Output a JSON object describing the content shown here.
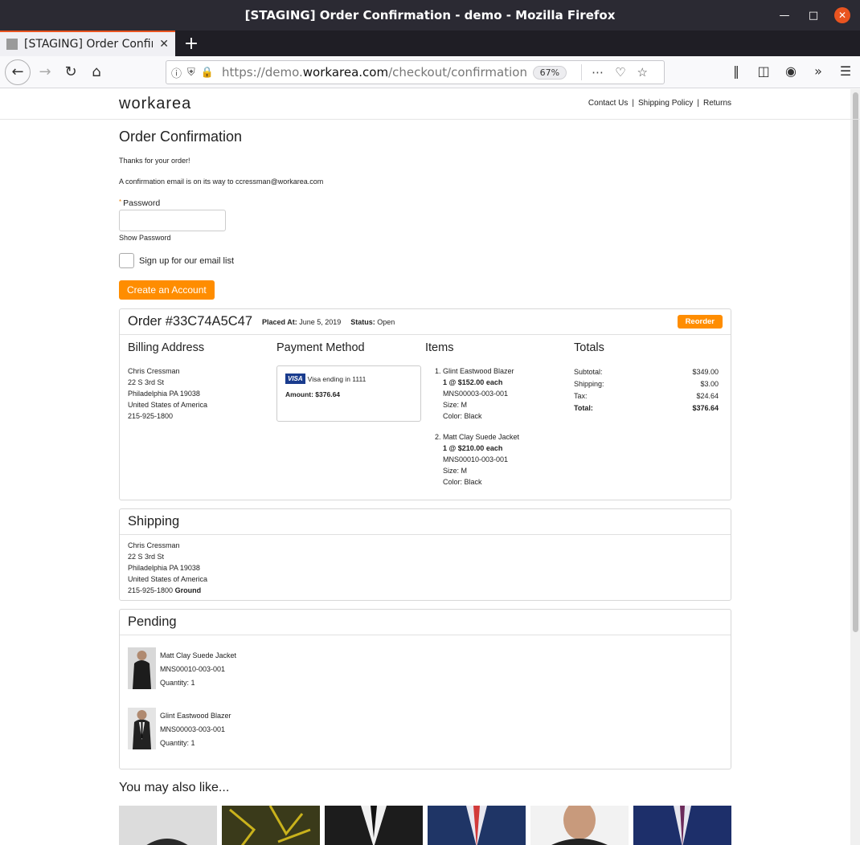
{
  "window": {
    "title": "[STAGING] Order Confirmation - demo - Mozilla Firefox",
    "tab_label": "[STAGING] Order Confirm",
    "url_prefix": "https://demo.",
    "url_domain": "workarea.com",
    "url_path": "/checkout/confirmation",
    "zoom": "67%"
  },
  "header": {
    "logo": "workarea",
    "links": [
      "Contact Us",
      "Shipping Policy",
      "Returns"
    ]
  },
  "page": {
    "title": "Order Confirmation",
    "thanks": "Thanks for your order!",
    "email_msg": "A confirmation email is on its way to ccressman@workarea.com",
    "password_label": "Password",
    "required_mark": "*",
    "show_password": "Show Password",
    "email_signup": "Sign up for our email list",
    "create_account": "Create an Account"
  },
  "order": {
    "number": "Order #33C74A5C47",
    "placed_label": "Placed At:",
    "placed_value": "June 5, 2019",
    "status_label": "Status:",
    "status_value": "Open",
    "reorder": "Reorder",
    "billing_title": "Billing Address",
    "billing": [
      "Chris Cressman",
      "22 S 3rd St",
      "Philadelphia PA 19038",
      "United States of America",
      "215-925-1800"
    ],
    "payment_title": "Payment Method",
    "card_brand": "VISA",
    "card_text": "Visa ending in 1111",
    "amount": "Amount: $376.64",
    "items_title": "Items",
    "items": [
      {
        "name": "Glint Eastwood Blazer",
        "qty": "1 @ $152.00 each",
        "sku": "MNS00003-003-001",
        "size": "Size: M",
        "color": "Color: Black"
      },
      {
        "name": "Matt Clay Suede Jacket",
        "qty": "1 @ $210.00 each",
        "sku": "MNS00010-003-001",
        "size": "Size: M",
        "color": "Color: Black"
      }
    ],
    "totals_title": "Totals",
    "totals": [
      {
        "label": "Subtotal:",
        "value": "$349.00"
      },
      {
        "label": "Shipping:",
        "value": "$3.00"
      },
      {
        "label": "Tax:",
        "value": "$24.64"
      },
      {
        "label": "Total:",
        "value": "$376.64"
      }
    ]
  },
  "shipping": {
    "title": "Shipping",
    "lines": [
      "Chris Cressman",
      "22 S 3rd St",
      "Philadelphia PA 19038",
      "United States of America"
    ],
    "phone": "215-925-1800",
    "method": "Ground"
  },
  "pending": {
    "title": "Pending",
    "items": [
      {
        "name": "Matt Clay Suede Jacket",
        "sku": "MNS00010-003-001",
        "qty": "Quantity: 1"
      },
      {
        "name": "Glint Eastwood Blazer",
        "sku": "MNS00003-003-001",
        "qty": "Quantity: 1"
      }
    ]
  },
  "recommendations": {
    "title": "You may also like..."
  }
}
